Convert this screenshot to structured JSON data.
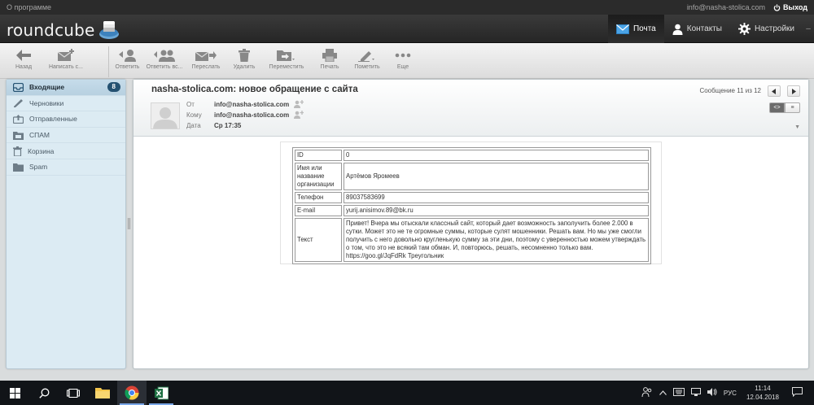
{
  "topline": {
    "about": "О программе",
    "user": "info@nasha-stolica.com",
    "logout": "Выход"
  },
  "logo": {
    "text": "roundcube"
  },
  "app_tabs": [
    {
      "label": "Почта",
      "icon": "envelope-icon"
    },
    {
      "label": "Контакты",
      "icon": "person-icon"
    },
    {
      "label": "Настройки",
      "icon": "gear-icon"
    }
  ],
  "toolbar": {
    "back": "Назад",
    "compose": "Написать с...",
    "reply": "Ответить",
    "reply_all": "Ответить вс...",
    "forward": "Переслать",
    "delete": "Удалить",
    "move": "Переместить",
    "print": "Печать",
    "mark": "Пометить",
    "more": "Еще"
  },
  "folders": [
    {
      "label": "Входящие",
      "badge": "8",
      "icon": "inbox-icon"
    },
    {
      "label": "Черновики",
      "badge": "",
      "icon": "pencil-icon"
    },
    {
      "label": "Отправленные",
      "badge": "",
      "icon": "sent-icon"
    },
    {
      "label": "СПАМ",
      "badge": "",
      "icon": "folder-spam-icon"
    },
    {
      "label": "Корзина",
      "badge": "",
      "icon": "trash-icon"
    },
    {
      "label": "Spam",
      "badge": "",
      "icon": "folder-icon"
    }
  ],
  "message": {
    "subject": "nasha-stolica.com: новое обращение с сайта",
    "from_label": "От",
    "from": "info@nasha-stolica.com",
    "to_label": "Кому",
    "to": "info@nasha-stolica.com",
    "date_label": "Дата",
    "date": "Ср 17:35",
    "counter": "Сообщение 11 из 12"
  },
  "form": {
    "rows": [
      {
        "key": "ID",
        "value": "0"
      },
      {
        "key": "Имя или название организации",
        "value": "Артёмов Яромеев"
      },
      {
        "key": "Телефон",
        "value": "89037583699"
      },
      {
        "key": "E-mail",
        "value": "yurij.anisimov.89@bk.ru"
      },
      {
        "key": "Текст",
        "value": "Привет! Вчера мы отыскали классный сайт, который дает возможность заполучить более 2.000 в сутки. Может это не те огромные суммы, которые сулят мошенники. Решать вам. Но мы уже смогли получить с него довольно кругленькую сумму за эти дни, поэтому с уверенностью можем утверждать о том, что это не всякий там обман. И, повторюсь, решать, несомненно только вам. https://goo.gl/JqFdRk Треугольник"
      }
    ]
  },
  "taskbar": {
    "lang": "РУС",
    "time": "11:14",
    "date": "12.04.2018"
  },
  "colors": {
    "accent": "#245171",
    "folder_bg": "#dcebf3",
    "header_bg": "#2b2b2b"
  }
}
